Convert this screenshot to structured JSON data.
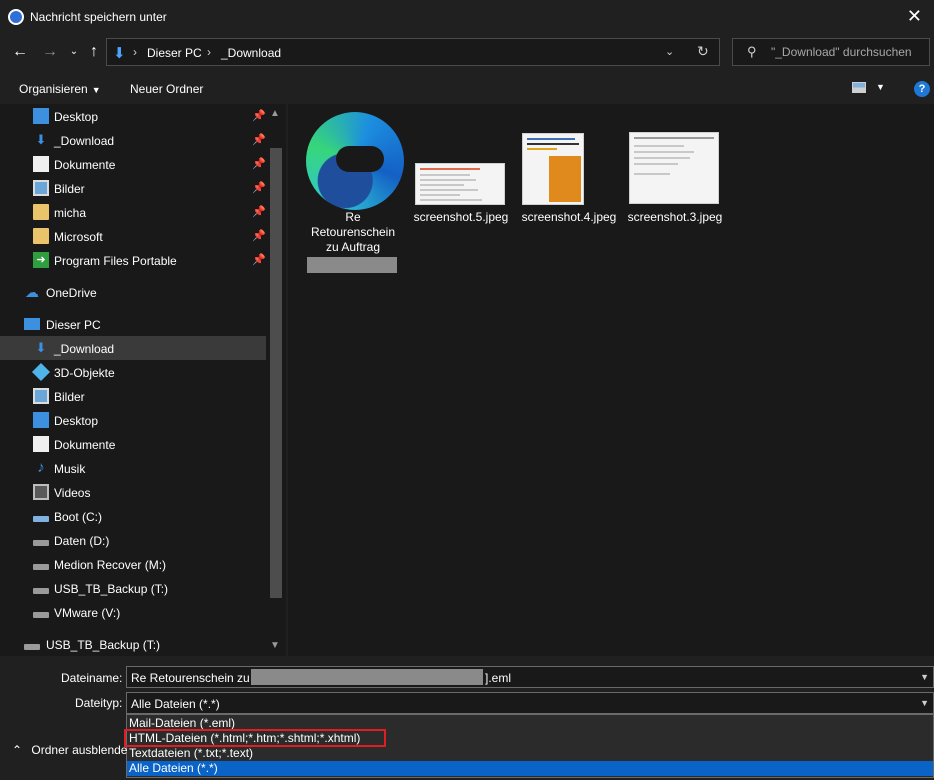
{
  "window": {
    "title": "Nachricht speichern unter",
    "close_label": "✕"
  },
  "nav": {
    "back": "←",
    "forward": "→",
    "up_level": "↓",
    "up": "↑",
    "path": [
      "Dieser PC",
      "_Download"
    ],
    "search_placeholder": "\"_Download\" durchsuchen"
  },
  "toolbar": {
    "organize": "Organisieren",
    "new_folder": "Neuer Ordner",
    "help": "?"
  },
  "sidebar": {
    "quick_access": [
      {
        "label": "Desktop",
        "icon": "desktop-icon",
        "pinned": true
      },
      {
        "label": "_Download",
        "icon": "download-icon",
        "pinned": true
      },
      {
        "label": "Dokumente",
        "icon": "documents-icon",
        "pinned": true
      },
      {
        "label": "Bilder",
        "icon": "pictures-icon",
        "pinned": true
      },
      {
        "label": "micha",
        "icon": "folder-icon",
        "pinned": true
      },
      {
        "label": "Microsoft",
        "icon": "folder-icon",
        "pinned": true
      },
      {
        "label": "Program Files Portable",
        "icon": "green-folder-icon",
        "pinned": true
      }
    ],
    "onedrive": "OneDrive",
    "this_pc": "Dieser PC",
    "pc_items": [
      {
        "label": "_Download",
        "icon": "download-icon",
        "selected": true
      },
      {
        "label": "3D-Objekte",
        "icon": "3d-objects-icon"
      },
      {
        "label": "Bilder",
        "icon": "pictures-icon"
      },
      {
        "label": "Desktop",
        "icon": "desktop-icon"
      },
      {
        "label": "Dokumente",
        "icon": "documents-icon"
      },
      {
        "label": "Musik",
        "icon": "music-icon"
      },
      {
        "label": "Videos",
        "icon": "videos-icon"
      },
      {
        "label": "Boot (C:)",
        "icon": "system-drive-icon"
      },
      {
        "label": "Daten (D:)",
        "icon": "drive-icon"
      },
      {
        "label": "Medion Recover (M:)",
        "icon": "drive-icon"
      },
      {
        "label": "USB_TB_Backup (T:)",
        "icon": "drive-icon"
      },
      {
        "label": "VMware (V:)",
        "icon": "drive-icon"
      }
    ],
    "usb_root": "USB_TB_Backup (T:)"
  },
  "files": [
    {
      "name": "Re\nRetourenschein\nzu Auftrag",
      "icon": "edge-icon"
    },
    {
      "name": "screenshot.5.jpeg",
      "icon": "image-thumbnail"
    },
    {
      "name": "screenshot.4.jpeg",
      "icon": "image-thumbnail"
    },
    {
      "name": "screenshot.3.jpeg",
      "icon": "image-thumbnail"
    }
  ],
  "form": {
    "filename_label": "Dateiname:",
    "filename_prefix": "Re  Retourenschein zu",
    "filename_suffix": "].eml",
    "filetype_label": "Dateityp:",
    "filetype_value": "Alle Dateien (*.*)",
    "filetype_options": [
      "Mail-Dateien (*.eml)",
      "HTML-Dateien (*.html;*.htm;*.shtml;*.xhtml)",
      "Textdateien (*.txt;*.text)",
      "Alle Dateien (*.*)"
    ],
    "highlighted_option": "HTML-Dateien (*.html;*.htm;*.shtml;*.xhtml)",
    "hide_folders": "Ordner ausblende"
  },
  "colors": {
    "accent": "#0a64c8",
    "highlight_box": "#e01c24",
    "background": "#191919"
  }
}
